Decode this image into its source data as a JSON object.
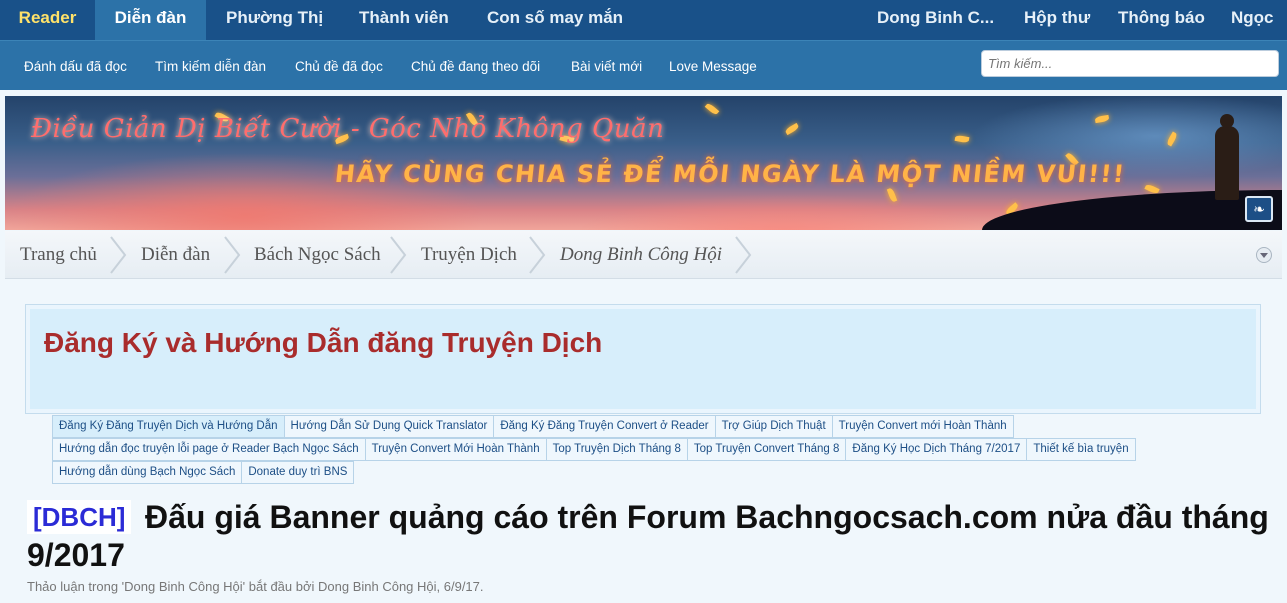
{
  "top_nav": {
    "reader": "Reader",
    "forum": "Diễn đàn",
    "market": "Phường Thị",
    "members": "Thành viên",
    "lucky_number": "Con số may mắn",
    "account": "Dong Binh C...",
    "inbox": "Hộp thư",
    "alerts": "Thông báo",
    "user": "Ngọc"
  },
  "sub_nav": {
    "items": [
      "Đánh dấu đã đọc",
      "Tìm kiếm diễn đàn",
      "Chủ đề đã đọc",
      "Chủ đề đang theo dõi",
      "Bài viết mới",
      "Love Message"
    ],
    "search_placeholder": "Tìm kiếm..."
  },
  "banner": {
    "line1": "Điều Giản Dị Biết Cười - Góc Nhỏ Không Quăn",
    "line2": "HÃY CÙNG CHIA SẺ ĐỂ MỖI NGÀY LÀ MỘT NIỀM VUI!!!"
  },
  "breadcrumb": [
    "Trang chủ",
    "Diễn đàn",
    "Bách Ngọc Sách",
    "Truyện Dịch",
    "Dong Binh Công Hội"
  ],
  "notice": {
    "title": "Đăng Ký và Hướng Dẫn đăng Truyện Dịch",
    "rows": [
      [
        "Đăng Ký Đăng Truyện Dịch và Hướng Dẫn",
        "Hướng Dẫn Sử Dụng Quick Translator",
        "Đăng Ký Đăng Truyện Convert ở Reader",
        "Trợ Giúp Dịch Thuật",
        "Truyện Convert mới Hoàn Thành"
      ],
      [
        "Hướng dẫn đọc truyện lỗi page ở Reader Bạch Ngọc Sách",
        "Truyện Convert Mới Hoàn Thành",
        "Top Truyện Dịch Tháng 8",
        "Top Truyện Convert Tháng 8",
        "Đăng Ký Học Dịch Tháng 7/2017",
        "Thiết kế bìa truyện"
      ],
      [
        "Hướng dẫn dùng Bạch Ngọc Sách",
        "Donate duy trì BNS"
      ]
    ]
  },
  "thread": {
    "prefix": "[DBCH]",
    "title": "Đấu giá Banner quảng cáo trên Forum Bachngocsach.com nửa đầu tháng 9/2017",
    "meta": "Thảo luận trong 'Dong Binh Công Hội' bắt đầu bởi Dong Binh Công Hội, 6/9/17."
  }
}
